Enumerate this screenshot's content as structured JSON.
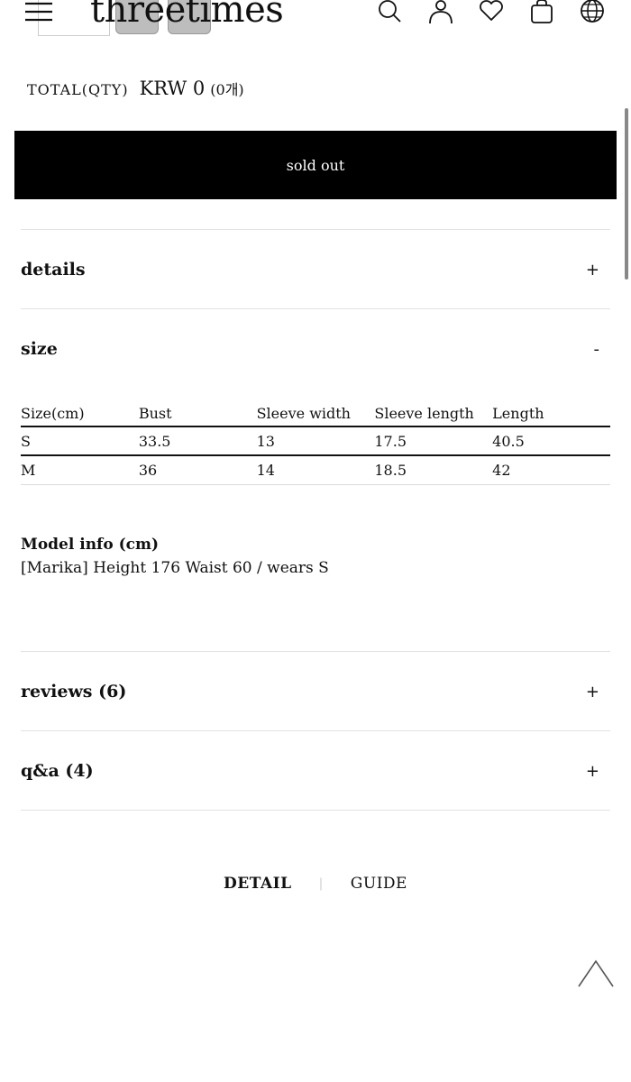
{
  "header": {
    "logo": "threetimes",
    "icons": [
      "menu-icon",
      "search-icon",
      "user-icon",
      "heart-icon",
      "bag-icon",
      "globe-icon"
    ]
  },
  "total": {
    "label": "TOTAL(QTY)",
    "price": "KRW 0",
    "qty": "(0개)"
  },
  "sold_out_label": "sold out",
  "accordion": {
    "details": {
      "title": "details",
      "toggle": "+"
    },
    "size": {
      "title": "size",
      "toggle": "-"
    },
    "reviews": {
      "title": "reviews (6)",
      "toggle": "+"
    },
    "qa": {
      "title": "q&a (4)",
      "toggle": "+"
    }
  },
  "size_table": {
    "headers": [
      "Size(cm)",
      "Bust",
      "Sleeve width",
      "Sleeve length",
      "Length"
    ],
    "rows": [
      [
        "S",
        "33.5",
        "13",
        "17.5",
        "40.5"
      ],
      [
        "M",
        "36",
        "14",
        "18.5",
        "42"
      ]
    ]
  },
  "model_info": {
    "title": "Model info (cm)",
    "text": "[Marika] Height 176 Waist 60 / wears S"
  },
  "tabs": {
    "detail": "DETAIL",
    "separator": "|",
    "guide": "GUIDE"
  },
  "colors": {
    "button_bg": "#000000",
    "button_text": "#ffffff",
    "divider": "#e2e2e2"
  }
}
